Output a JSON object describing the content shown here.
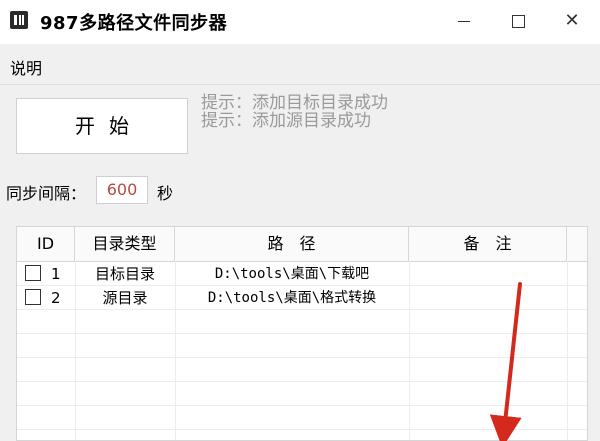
{
  "window": {
    "title": "987多路径文件同步器",
    "minimize": "—",
    "maximize": "☐",
    "close": "✕"
  },
  "menu": {
    "items": [
      "说明"
    ]
  },
  "controls": {
    "start_label": "开始",
    "hint1": "提示：添加目标目录成功",
    "hint2": "提示：添加源目录成功",
    "interval_label": "同步间隔：",
    "interval_value": "600",
    "interval_unit": "秒"
  },
  "table": {
    "headers": [
      "ID",
      "目录类型",
      "路　径",
      "备　注"
    ],
    "rows": [
      {
        "id": "1",
        "type": "目标目录",
        "path": "D:\\tools\\桌面\\下载吧",
        "note": "",
        "checked": false
      },
      {
        "id": "2",
        "type": "源目录",
        "path": "D:\\tools\\桌面\\格式转换",
        "note": "",
        "checked": false
      }
    ]
  },
  "colors": {
    "interval_value": "#b24b3e",
    "hint": "#9a9a9a",
    "arrow": "#d42a1e"
  }
}
